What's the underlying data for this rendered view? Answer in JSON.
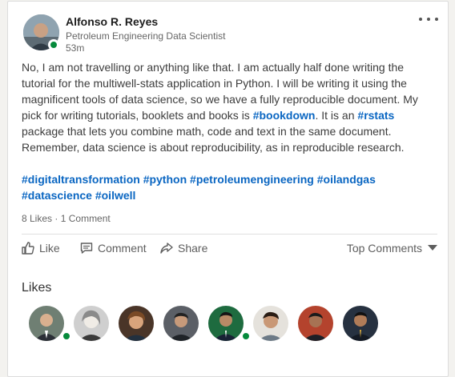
{
  "author": {
    "name": "Alfonso R. Reyes",
    "title": "Petroleum Engineering Data Scientist",
    "time": "53m"
  },
  "post": {
    "p1": "No, I am not travelling or anything like that. I am actually half done writing the tutorial for the multiwell-stats application in Python. I will be writing it using the magnificent tools of data science, so we have a fully reproducible document. My pick for writing tutorials, booklets and books is ",
    "tag_bookdown": "#bookdown",
    "p2": ". It is an ",
    "tag_rstats": "#rstats",
    "p3": " package that lets you combine math, code and text in the same document. Remember, data science is about reproducibility, as in reproducible research."
  },
  "hashtags": [
    "#digitaltransformation",
    "#python",
    "#petroleumengineering",
    "#oilandgas",
    "#datascience",
    "#oilwell"
  ],
  "social": {
    "likes": "8 Likes",
    "separator": "·",
    "comments": "1 Comment"
  },
  "actions": {
    "like": "Like",
    "comment": "Comment",
    "share": "Share",
    "top_comments": "Top Comments"
  },
  "likes_section": {
    "heading": "Likes"
  },
  "colors": {
    "link": "#0a66c2",
    "presence": "#058a3b"
  }
}
